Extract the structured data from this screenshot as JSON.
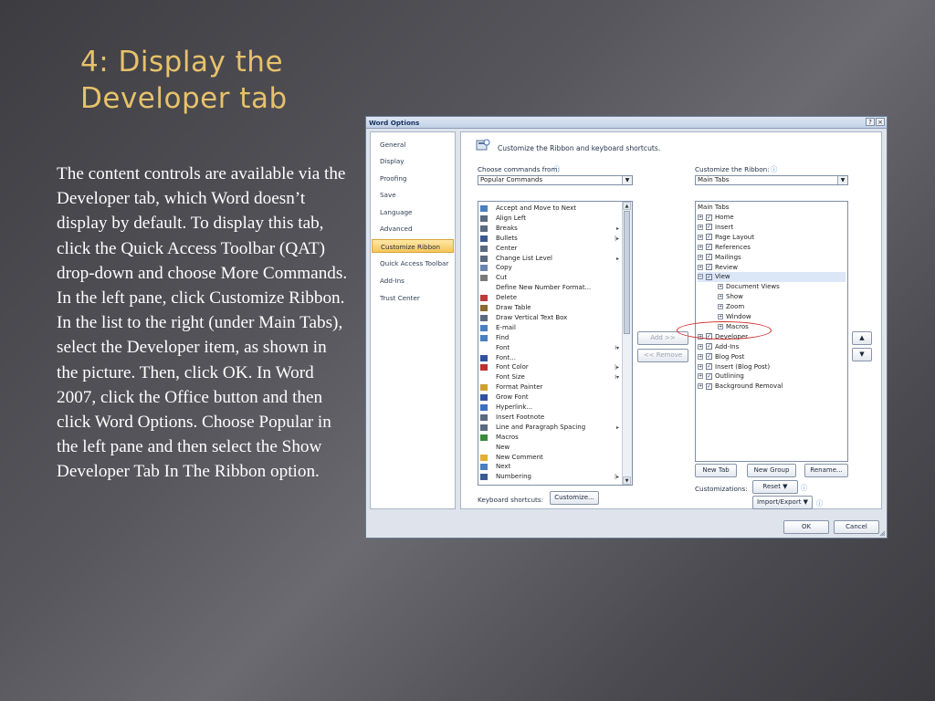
{
  "slide": {
    "title": "4: Display the Developer tab",
    "body": "The content controls are available via the Developer tab, which Word doesn’t display by default. To display this tab, click the Quick Access Toolbar (QAT) drop-down and choose More Commands. In the left pane, click Customize Ribbon. In the list to the right (under Main Tabs), select the Developer item, as shown in the picture. Then, click OK. In Word 2007, click the Office button and then click Word Options. Choose Popular in the left pane and then select the Show Developer Tab In The Ribbon option."
  },
  "dialog": {
    "title": "Word Options",
    "help_label": "?",
    "close_label": "×",
    "nav": [
      "General",
      "Display",
      "Proofing",
      "Save",
      "Language",
      "Advanced",
      "Customize Ribbon",
      "Quick Access Toolbar",
      "Add-Ins",
      "Trust Center"
    ],
    "nav_selected": "Customize Ribbon",
    "heading": "Customize the Ribbon and keyboard shortcuts.",
    "choose_label": "Choose commands from:",
    "choose_value": "Popular Commands",
    "customize_label": "Customize the Ribbon:",
    "customize_value": "Main Tabs",
    "commands": [
      {
        "label": "Accept and Move to Next",
        "icon": "accept-change-icon",
        "sub": ""
      },
      {
        "label": "Align Left",
        "icon": "align-left-icon",
        "sub": ""
      },
      {
        "label": "Breaks",
        "icon": "breaks-icon",
        "sub": "▸"
      },
      {
        "label": "Bullets",
        "icon": "bullets-icon",
        "sub": "|▸"
      },
      {
        "label": "Center",
        "icon": "center-icon",
        "sub": ""
      },
      {
        "label": "Change List Level",
        "icon": "list-level-icon",
        "sub": "▸"
      },
      {
        "label": "Copy",
        "icon": "copy-icon",
        "sub": ""
      },
      {
        "label": "Cut",
        "icon": "cut-icon",
        "sub": ""
      },
      {
        "label": "Define New Number Format...",
        "icon": "",
        "sub": ""
      },
      {
        "label": "Delete",
        "icon": "delete-icon",
        "sub": ""
      },
      {
        "label": "Draw Table",
        "icon": "draw-table-icon",
        "sub": ""
      },
      {
        "label": "Draw Vertical Text Box",
        "icon": "text-box-icon",
        "sub": ""
      },
      {
        "label": "E-mail",
        "icon": "email-icon",
        "sub": ""
      },
      {
        "label": "Find",
        "icon": "find-icon",
        "sub": ""
      },
      {
        "label": "Font",
        "icon": "",
        "sub": "I▾"
      },
      {
        "label": "Font...",
        "icon": "font-dialog-icon",
        "sub": ""
      },
      {
        "label": "Font Color",
        "icon": "font-color-icon",
        "sub": "|▸"
      },
      {
        "label": "Font Size",
        "icon": "",
        "sub": "I▾"
      },
      {
        "label": "Format Painter",
        "icon": "format-painter-icon",
        "sub": ""
      },
      {
        "label": "Grow Font",
        "icon": "grow-font-icon",
        "sub": ""
      },
      {
        "label": "Hyperlink...",
        "icon": "hyperlink-icon",
        "sub": ""
      },
      {
        "label": "Insert Footnote",
        "icon": "footnote-icon",
        "sub": ""
      },
      {
        "label": "Line and Paragraph Spacing",
        "icon": "line-spacing-icon",
        "sub": "▸"
      },
      {
        "label": "Macros",
        "icon": "macros-icon",
        "sub": ""
      },
      {
        "label": "New",
        "icon": "new-document-icon",
        "sub": ""
      },
      {
        "label": "New Comment",
        "icon": "new-comment-icon",
        "sub": ""
      },
      {
        "label": "Next",
        "icon": "next-icon",
        "sub": ""
      },
      {
        "label": "Numbering",
        "icon": "numbering-icon",
        "sub": "|▸"
      }
    ],
    "tree_header": "Main Tabs",
    "tree": [
      {
        "label": "Home",
        "level": 1,
        "exp": "⊞",
        "chk": true
      },
      {
        "label": "Insert",
        "level": 1,
        "exp": "⊞",
        "chk": true
      },
      {
        "label": "Page Layout",
        "level": 1,
        "exp": "⊞",
        "chk": true
      },
      {
        "label": "References",
        "level": 1,
        "exp": "⊞",
        "chk": true
      },
      {
        "label": "Mailings",
        "level": 1,
        "exp": "⊞",
        "chk": true
      },
      {
        "label": "Review",
        "level": 1,
        "exp": "⊞",
        "chk": true
      },
      {
        "label": "View",
        "level": 1,
        "exp": "⊟",
        "chk": true,
        "selected": true
      },
      {
        "label": "Document Views",
        "level": 2,
        "exp": "⊞",
        "chk": false
      },
      {
        "label": "Show",
        "level": 2,
        "exp": "⊞",
        "chk": false
      },
      {
        "label": "Zoom",
        "level": 2,
        "exp": "⊞",
        "chk": false
      },
      {
        "label": "Window",
        "level": 2,
        "exp": "⊞",
        "chk": false
      },
      {
        "label": "Macros",
        "level": 2,
        "exp": "⊞",
        "chk": false
      },
      {
        "label": "Developer",
        "level": 1,
        "exp": "⊞",
        "chk": true
      },
      {
        "label": "Add-Ins",
        "level": 1,
        "exp": "⊞",
        "chk": true
      },
      {
        "label": "Blog Post",
        "level": 1,
        "exp": "⊞",
        "chk": true
      },
      {
        "label": "Insert (Blog Post)",
        "level": 1,
        "exp": "⊞",
        "chk": true
      },
      {
        "label": "Outlining",
        "level": 1,
        "exp": "⊞",
        "chk": true
      },
      {
        "label": "Background Removal",
        "level": 1,
        "exp": "⊞",
        "chk": true
      }
    ],
    "add_label": "Add >>",
    "remove_label": "<< Remove",
    "move_up": "▲",
    "move_down": "▼",
    "new_tab": "New Tab",
    "new_group": "New Group",
    "rename": "Rename...",
    "customizations_label": "Customizations:",
    "reset": "Reset ▼",
    "import_export": "Import/Export ▼",
    "keyboard_label": "Keyboard shortcuts:",
    "customize_btn": "Customize...",
    "ok": "OK",
    "cancel": "Cancel",
    "info_glyph": "ⓘ",
    "check_glyph": "✓"
  }
}
